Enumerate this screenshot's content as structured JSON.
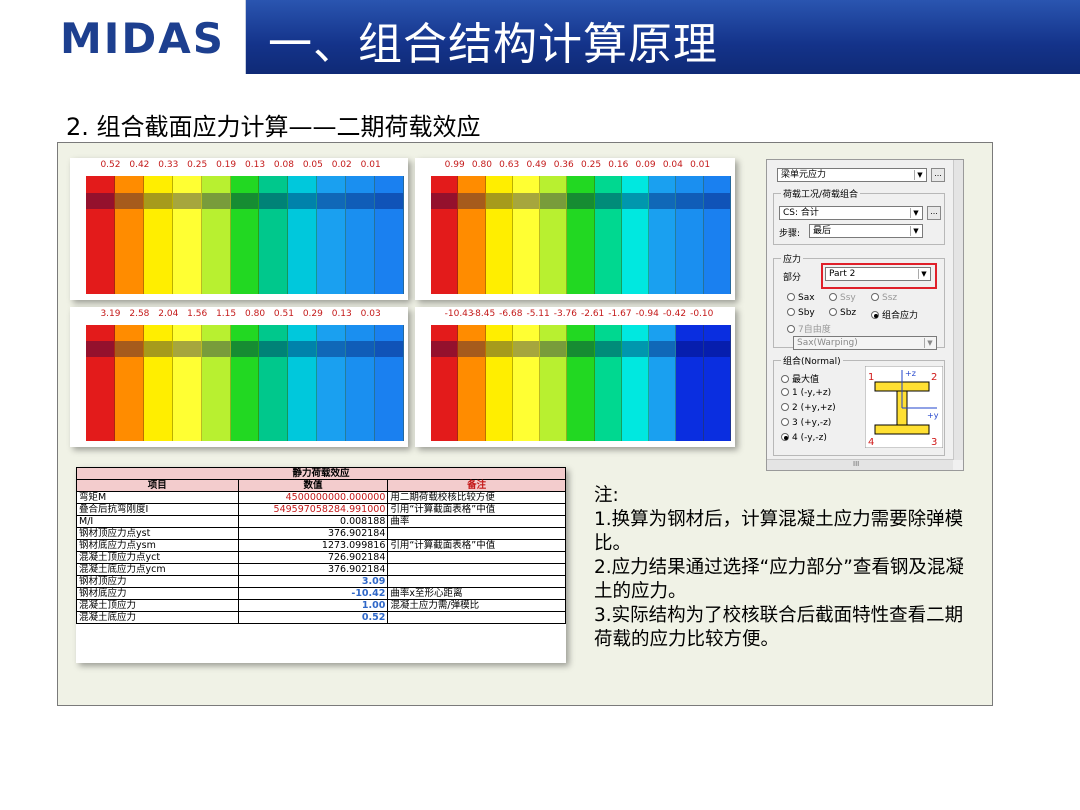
{
  "header": {
    "logo_text": "MIDAS",
    "title": "一、组合结构计算原理"
  },
  "subtitle": "2. 组合截面应力计算——二期荷载效应",
  "contours": [
    {
      "labels": [
        "0.52",
        "0.42",
        "0.33",
        "0.25",
        "0.19",
        "0.13",
        "0.08",
        "0.05",
        "0.02",
        "0.01"
      ],
      "colors": [
        "#e31b1b",
        "#ff8c00",
        "#ffee00",
        "#ffff33",
        "#b8f030",
        "#22d822",
        "#00c88c",
        "#00c8dc",
        "#1aa0f0",
        "#1a8ff0",
        "#1a80f0"
      ]
    },
    {
      "labels": [
        "0.99",
        "0.80",
        "0.63",
        "0.49",
        "0.36",
        "0.25",
        "0.16",
        "0.09",
        "0.04",
        "0.01"
      ],
      "colors": [
        "#e31b1b",
        "#ff8c00",
        "#ffee00",
        "#ffff33",
        "#b8f030",
        "#22d822",
        "#00d890",
        "#00e8e0",
        "#1aa0f0",
        "#1a8ff0",
        "#1a80f0"
      ]
    },
    {
      "labels": [
        "3.19",
        "2.58",
        "2.04",
        "1.56",
        "1.15",
        "0.80",
        "0.51",
        "0.29",
        "0.13",
        "0.03"
      ],
      "colors": [
        "#e31b1b",
        "#ff8c00",
        "#ffee00",
        "#ffff33",
        "#b8f030",
        "#22d822",
        "#00c88c",
        "#00c8dc",
        "#1aa0f0",
        "#1a8ff0",
        "#1a80f0"
      ]
    },
    {
      "labels": [
        "-10.43",
        "-8.45",
        "-6.68",
        "-5.11",
        "-3.76",
        "-2.61",
        "-1.67",
        "-0.94",
        "-0.42",
        "-0.10"
      ],
      "colors": [
        "#e31b1b",
        "#ff8c00",
        "#ffee00",
        "#ffff33",
        "#b8f030",
        "#22d822",
        "#00d890",
        "#00e8e0",
        "#1aa0f0",
        "#0a2ee0",
        "#0a2ee0"
      ]
    }
  ],
  "panel": {
    "result_type": "梁单元应力",
    "group_loadcase": "荷载工况/荷载组合",
    "cs_value": "CS: 合计",
    "step_label": "步骤:",
    "step_value": "最后",
    "stress_group": "应力",
    "part_label": "部分",
    "part_value": "Part 2",
    "opt_sax": "Sax",
    "opt_ssy": "Ssy",
    "opt_ssz": "Ssz",
    "opt_sby": "Sby",
    "opt_sbz": "Sbz",
    "opt_combined": "组合应力",
    "opt_7dof": "7自由度",
    "warping_value": "Sax(Warping)",
    "normal_group": "组合(Normal)",
    "opt_max": "最大值",
    "opt_1": "1 (-y,+z)",
    "opt_2": "2 (+y,+z)",
    "opt_3": "3 (+y,-z)",
    "opt_4": "4 (-y,-z)",
    "pt1": "1",
    "pt2": "2",
    "pt3": "3",
    "pt4": "4",
    "axis_z": "+z",
    "axis_y": "+y",
    "ellipsis": "...",
    "scroll_mark": "III"
  },
  "table": {
    "caption": "静力荷载效应",
    "headers": [
      "项目",
      "数值",
      "备注"
    ],
    "rows": [
      {
        "item": "弯矩M",
        "value": "4500000000.000000",
        "note": "用二期荷载校核比较方便",
        "style": "red"
      },
      {
        "item": "叠合后抗弯刚度I",
        "value": "549597058284.991000",
        "note": "引用“计算截面表格”中值",
        "style": "red"
      },
      {
        "item": "M/I",
        "value": "0.008188",
        "note": "曲率",
        "style": ""
      },
      {
        "item": "钢材顶应力点yst",
        "value": "376.902184",
        "note": "",
        "style": ""
      },
      {
        "item": "钢材底应力点ysm",
        "value": "1273.099816",
        "note": "引用“计算截面表格”中值",
        "style": ""
      },
      {
        "item": "混凝土顶应力点yct",
        "value": "726.902184",
        "note": "",
        "style": ""
      },
      {
        "item": "混凝土底应力点ycm",
        "value": "376.902184",
        "note": "",
        "style": ""
      },
      {
        "item": "钢材顶应力",
        "value": "3.09",
        "note": "",
        "style": "blue"
      },
      {
        "item": "钢材底应力",
        "value": "-10.42",
        "note": "曲率x至形心距离",
        "style": "blue"
      },
      {
        "item": "混凝土顶应力",
        "value": "1.00",
        "note": "混凝土应力需/弹模比",
        "style": "blue"
      },
      {
        "item": "混凝土底应力",
        "value": "0.52",
        "note": "",
        "style": "blue"
      }
    ]
  },
  "notes": {
    "heading": "注:",
    "items": [
      "1.换算为钢材后，计算混凝土应力需要除弹模比。",
      "2.应力结果通过选择“应力部分”查看钢及混凝土的应力。",
      "3.实际结构为了校核联合后截面特性查看二期荷载的应力比较方便。"
    ]
  }
}
